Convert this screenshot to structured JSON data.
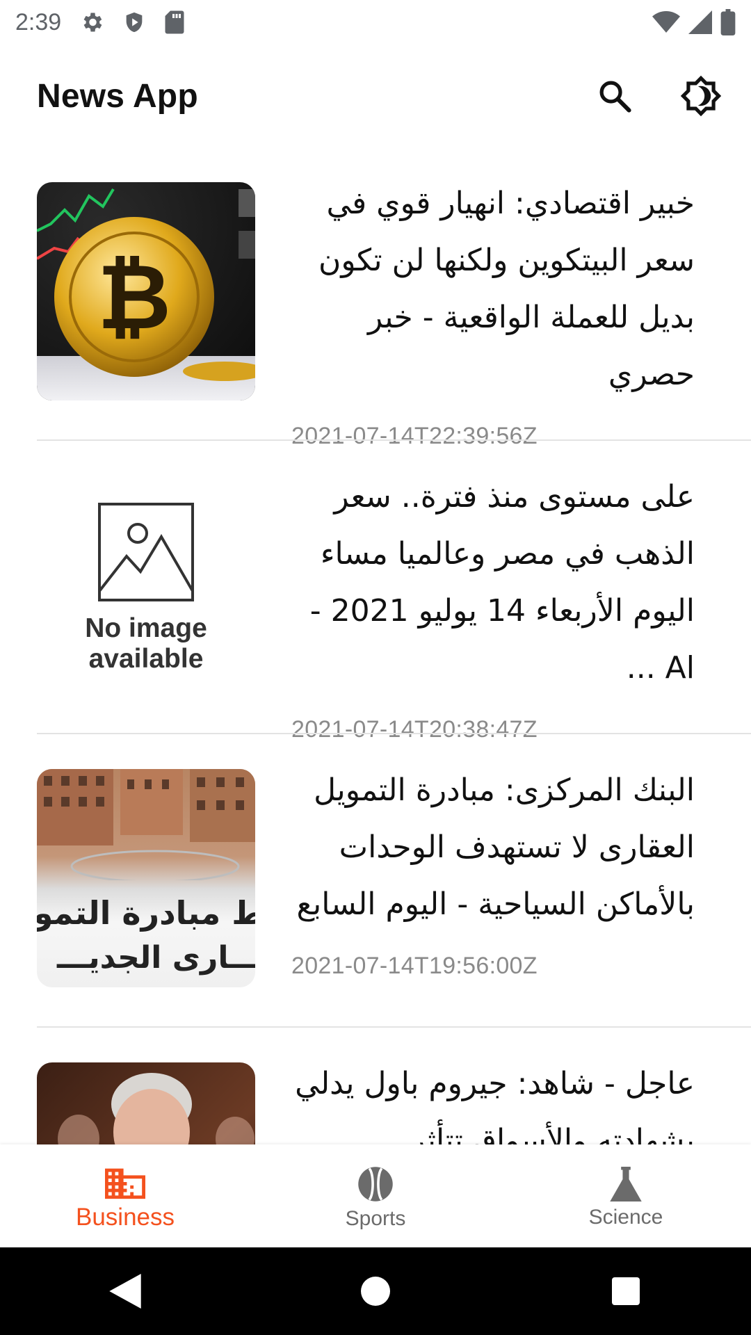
{
  "status_bar": {
    "time": "2:39",
    "icons": [
      "settings-gear-icon",
      "shield-play-icon",
      "sd-card-icon",
      "wifi-icon",
      "signal-icon",
      "battery-icon"
    ]
  },
  "app_bar": {
    "title": "News App",
    "actions": [
      "search-icon",
      "theme-toggle-icon"
    ]
  },
  "articles": [
    {
      "title": "خبير اقتصادي: انهيار قوي في سعر البيتكوين ولكنها لن تكون بديل للعملة الواقعية - خبر حصري",
      "date": "2021-07-14T22:39:56Z",
      "image": "bitcoin-photo"
    },
    {
      "title": "على مستوى منذ فترة.. سعر الذهب في مصر وعالميا مساء اليوم الأربعاء 14 يوليو 2021 - Al ...",
      "date": "2021-07-14T20:38:47Z",
      "image": "placeholder",
      "placeholder_text": "No image available"
    },
    {
      "title": "البنك المركزى: مبادرة التمويل العقارى لا تستهدف الوحدات بالأماكن السياحية - اليوم السابع",
      "date": "2021-07-14T19:56:00Z",
      "image": "buildings-photo",
      "image_caption_line1": "ط مبادرة التمو",
      "image_caption_line2": "ـــارى الجديـــ"
    },
    {
      "title": "عاجل - شاهد: جيروم باول يدلي بشهادته والأسواق تتأثر",
      "date": "",
      "image": "person-photo"
    }
  ],
  "bottom_nav": {
    "items": [
      {
        "label": "Business",
        "icon": "building-icon",
        "active": true
      },
      {
        "label": "Sports",
        "icon": "ball-icon",
        "active": false
      },
      {
        "label": "Science",
        "icon": "flask-icon",
        "active": false
      }
    ],
    "active_color": "#f4511e"
  },
  "system_nav": [
    "back-icon",
    "home-icon",
    "recents-icon"
  ]
}
